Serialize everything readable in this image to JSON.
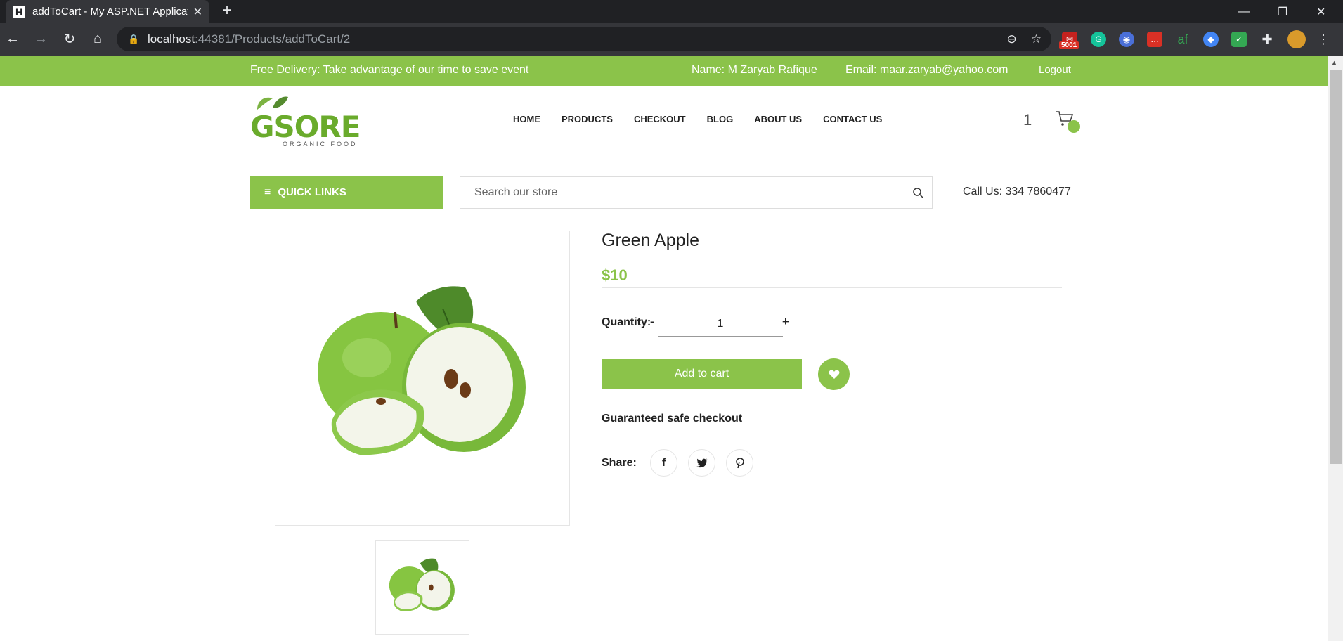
{
  "browser": {
    "tab_title": "addToCart - My ASP.NET Applicat",
    "url_host": "localhost",
    "url_path": ":44381/Products/addToCart/2",
    "ext_badge": "5001",
    "ext_badge2": "1"
  },
  "topbar": {
    "promo": "Free Delivery: Take advantage of our time to save event",
    "name": "Name: M Zaryab Rafique",
    "email": "Email: maar.zaryab@yahoo.com",
    "logout": "Logout"
  },
  "logo": {
    "word": "GSORE",
    "sub": "ORGANIC FOOD"
  },
  "nav": [
    "HOME",
    "PRODUCTS",
    "CHECKOUT",
    "BLOG",
    "ABOUT US",
    "CONTACT US"
  ],
  "cart": {
    "count": "1"
  },
  "quicklinks": "QUICK LINKS",
  "search": {
    "placeholder": "Search our store"
  },
  "call": "Call Us: 334 7860477",
  "product": {
    "title": "Green Apple",
    "price": "$10",
    "qty_label": "Quantity:",
    "qty_minus": "-",
    "qty_value": "1",
    "qty_plus": "+",
    "add_label": "Add to cart",
    "guarantee": "Guaranteed safe checkout",
    "share_label": "Share:"
  },
  "colors": {
    "accent": "#8bc34a",
    "chrome_dark": "#202124",
    "chrome_toolbar": "#35363a"
  }
}
